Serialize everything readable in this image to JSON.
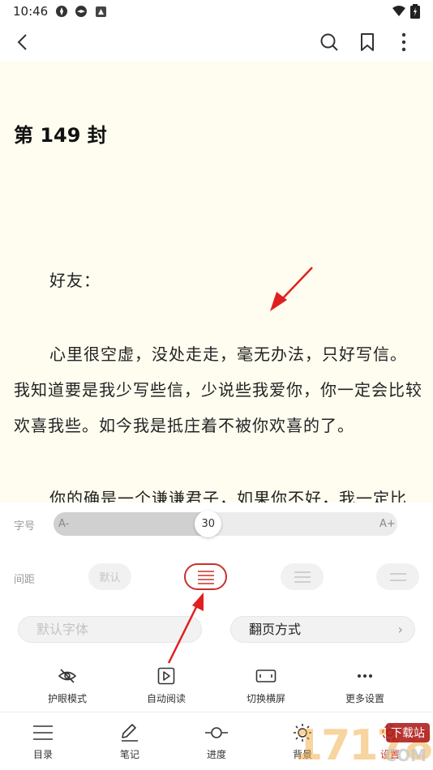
{
  "status_bar": {
    "time": "10:46",
    "icons": [
      "app-icon",
      "app-icon",
      "notification-icon",
      "wifi-icon",
      "battery-icon"
    ]
  },
  "app_bar": {
    "icons": [
      "back-icon",
      "search-icon",
      "bookmark-icon",
      "more-icon"
    ]
  },
  "content": {
    "chapter_title": "第 149 封",
    "salutation": "好友：",
    "paragraph_1": "心里很空虚，没处走走，毫无办法，只好写信。我知道要是我少写些信，少说些我爱你，你一定会比较欢喜我些。如今我是抵庄着不被你欢喜的了。",
    "paragraph_2_partial": "你的确是一个谦谦君子，如果你不好，我一定比"
  },
  "settings": {
    "font_size_label": "字号",
    "font_size_value": "30",
    "font_size_fraction": 0.45,
    "font_smaller": "A-",
    "font_larger": "A+",
    "spacing_label": "间距",
    "spacing_default": "默认",
    "font_button": "默认字体",
    "page_turn_button": "翻页方式",
    "page_turn_chevron": "›",
    "tools": [
      {
        "label": "护眼模式",
        "icon": "eye-off-icon"
      },
      {
        "label": "自动阅读",
        "icon": "play-icon"
      },
      {
        "label": "切换横屏",
        "icon": "landscape-icon"
      },
      {
        "label": "更多设置",
        "icon": "more-horizontal-icon"
      }
    ]
  },
  "bottom_nav": [
    {
      "label": "目录",
      "icon": "list-icon"
    },
    {
      "label": "笔记",
      "icon": "edit-icon"
    },
    {
      "label": "进度",
      "icon": "progress-icon"
    },
    {
      "label": "背景",
      "icon": "brightness-icon"
    },
    {
      "label": "设置",
      "icon": "settings-icon"
    }
  ],
  "watermark": {
    "text": "17178",
    "suffix": "下载站",
    "domain": "COM"
  },
  "colors": {
    "accent": "#c9302c",
    "reader_bg": "#fffdf0",
    "arrow": "#e02020"
  }
}
